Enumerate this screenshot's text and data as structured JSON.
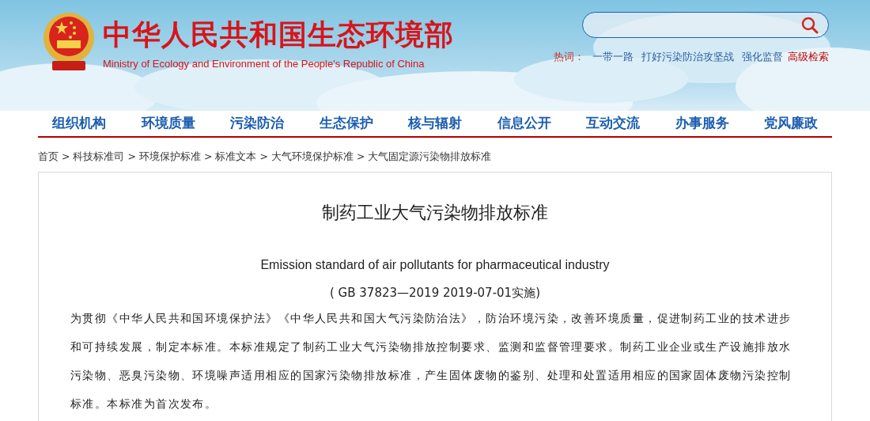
{
  "header": {
    "title": "中华人民共和国生态环境部",
    "subtitle": "Ministry of Ecology and Environment of the People's Republic of China",
    "hot_words_label": "热词：",
    "hot_words": [
      "一带一路",
      "打好污染防治攻坚战",
      "强化监督"
    ],
    "advanced_search": "高级检索"
  },
  "nav": {
    "items": [
      "组织机构",
      "环境质量",
      "污染防治",
      "生态保护",
      "核与辐射",
      "信息公开",
      "互动交流",
      "办事服务",
      "党风廉政"
    ]
  },
  "breadcrumb": {
    "separator": ">",
    "items": [
      "首页",
      "科技标准司",
      "环境保护标准",
      "标准文本",
      "大气环境保护标准",
      "大气固定源污染物排放标准"
    ]
  },
  "article": {
    "title": "制药工业大气污染物排放标准",
    "english_title": "Emission standard of air pollutants for pharmaceutical industry",
    "code": "( GB 37823—2019 2019-07-01实施)",
    "paragraph": "为贯彻《中华人民共和国环境保护法》《中华人民共和国大气污染防治法》，防治环境污染，改善环境质量，促进制药工业的技术进步和可持续发展，制定本标准。本标准规定了制药工业大气污染物排放控制要求、监测和监督管理要求。制药工业企业或生产设施排放水污染物、恶臭污染物、环境噪声适用相应的国家污染物排放标准，产生固体废物的鉴别、处理和处置适用相应的国家固体废物污染控制标准。本标准为首次发布。"
  }
}
